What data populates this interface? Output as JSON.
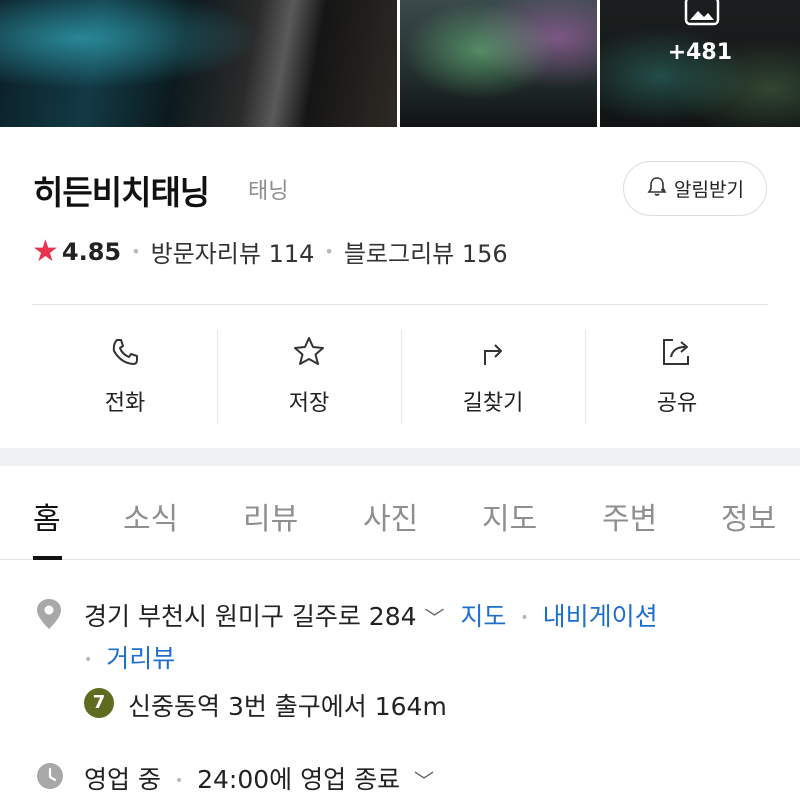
{
  "photos": {
    "more_count": "+481"
  },
  "place": {
    "name": "히든비치태닝",
    "category": "태닝",
    "notify_label": "알림받기"
  },
  "rating": {
    "score": "4.85",
    "visitor_reviews": "방문자리뷰 114",
    "blog_reviews": "블로그리뷰 156"
  },
  "actions": [
    {
      "label": "전화",
      "icon": "phone-icon"
    },
    {
      "label": "저장",
      "icon": "star-outline-icon"
    },
    {
      "label": "길찾기",
      "icon": "directions-icon"
    },
    {
      "label": "공유",
      "icon": "share-icon"
    }
  ],
  "tabs": [
    "홈",
    "소식",
    "리뷰",
    "사진",
    "지도",
    "주변",
    "정보"
  ],
  "address": {
    "text": "경기 부천시 원미구 길주로 284",
    "map_link": "지도",
    "navigation_link": "내비게이션",
    "streetview_link": "거리뷰"
  },
  "subway": {
    "line": "7",
    "text": "신중동역 3번 출구에서 164m",
    "line_color": "#5f6b1f"
  },
  "hours": {
    "status": "영업 중",
    "text": "24:00에 영업 종료"
  },
  "colors": {
    "link": "#1e6fd1",
    "star": "#e8344e"
  }
}
